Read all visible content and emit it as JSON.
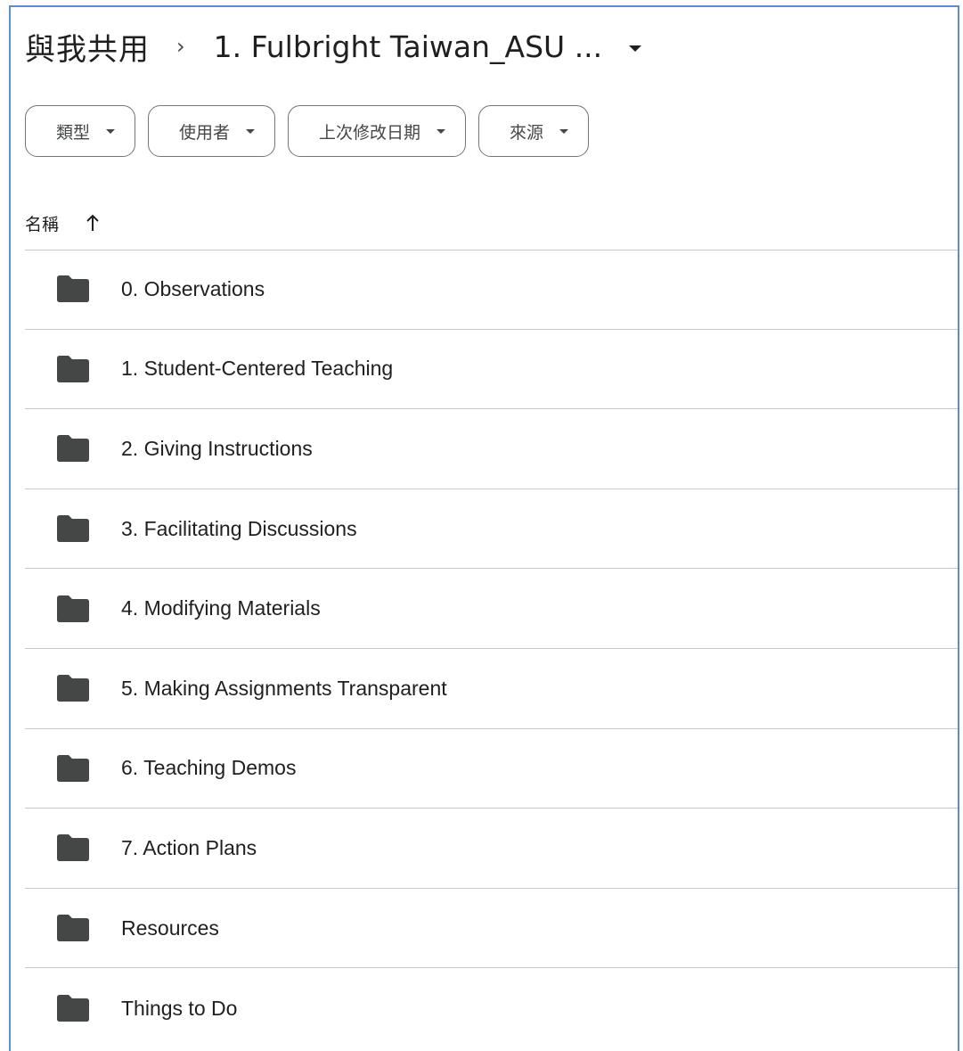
{
  "breadcrumb": {
    "root": "與我共用",
    "separator": "›",
    "current": "1. Fulbright Taiwan_ASU ..."
  },
  "filters": [
    {
      "label": "類型"
    },
    {
      "label": "使用者"
    },
    {
      "label": "上次修改日期"
    },
    {
      "label": "來源"
    }
  ],
  "list_header": {
    "name_label": "名稱",
    "sort_icon": "arrow-up-icon"
  },
  "items": [
    {
      "name": "0. Observations",
      "icon": "folder-icon"
    },
    {
      "name": "1. Student-Centered Teaching",
      "icon": "folder-icon"
    },
    {
      "name": "2. Giving Instructions",
      "icon": "folder-icon"
    },
    {
      "name": "3. Facilitating Discussions",
      "icon": "folder-icon"
    },
    {
      "name": "4. Modifying Materials",
      "icon": "folder-icon"
    },
    {
      "name": "5. Making Assignments Transparent",
      "icon": "folder-icon"
    },
    {
      "name": "6. Teaching Demos",
      "icon": "folder-icon"
    },
    {
      "name": "7. Action Plans",
      "icon": "folder-icon"
    },
    {
      "name": "Resources",
      "icon": "folder-icon"
    },
    {
      "name": "Things to Do",
      "icon": "folder-icon"
    }
  ],
  "colors": {
    "frame_border": "#5b8bd1",
    "text": "#1f1f1f",
    "folder": "#444746",
    "divider": "#c7c7c7"
  }
}
